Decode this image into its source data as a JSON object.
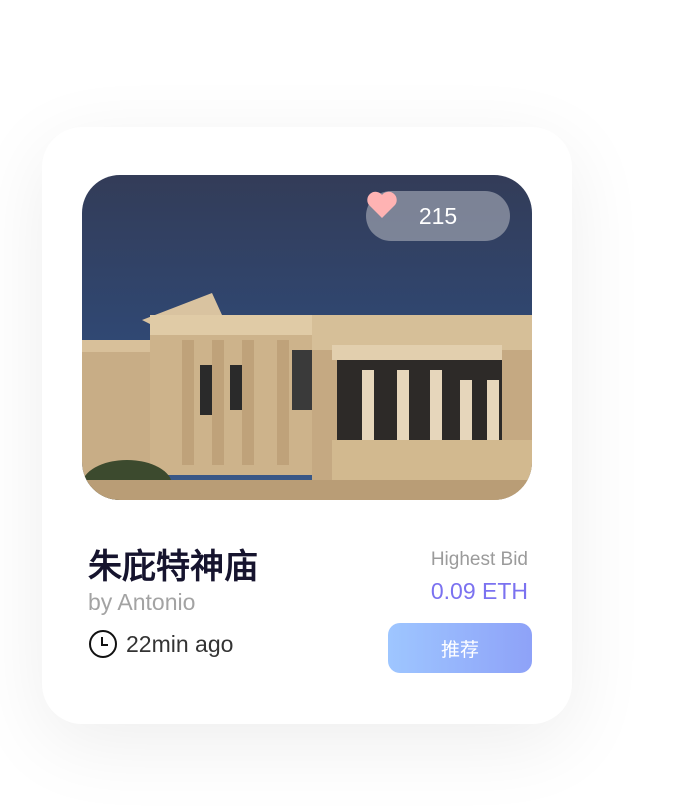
{
  "card": {
    "likes": "215",
    "title": "朱庇特神庙",
    "author": "by Antonio",
    "time": "22min ago",
    "bid_label": "Highest Bid",
    "bid_value": "0.09 ETH",
    "button_label": "推荐"
  },
  "colors": {
    "accent": "#7b72f0",
    "heart": "#ffb3b3",
    "title": "#16142e"
  }
}
